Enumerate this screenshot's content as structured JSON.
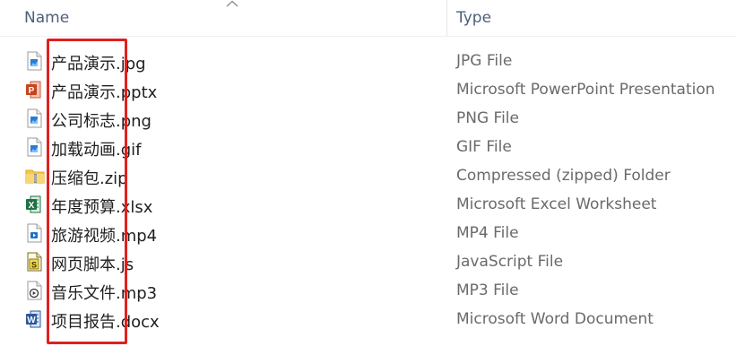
{
  "header": {
    "name_label": "Name",
    "type_label": "Type",
    "sort_icon": "chevron-up-icon"
  },
  "files": [
    {
      "name": "产品演示.jpg",
      "type": "JPG File",
      "icon": "image-file-icon"
    },
    {
      "name": "产品演示.pptx",
      "type": "Microsoft PowerPoint Presentation",
      "icon": "powerpoint-file-icon"
    },
    {
      "name": "公司标志.png",
      "type": "PNG File",
      "icon": "image-file-icon"
    },
    {
      "name": "加载动画.gif",
      "type": "GIF File",
      "icon": "image-file-icon"
    },
    {
      "name": "压缩包.zip",
      "type": "Compressed (zipped) Folder",
      "icon": "zip-folder-icon"
    },
    {
      "name": "年度预算.xlsx",
      "type": "Microsoft Excel Worksheet",
      "icon": "excel-file-icon"
    },
    {
      "name": "旅游视频.mp4",
      "type": "MP4 File",
      "icon": "video-file-icon"
    },
    {
      "name": "网页脚本.js",
      "type": "JavaScript File",
      "icon": "script-file-icon"
    },
    {
      "name": "音乐文件.mp3",
      "type": "MP3 File",
      "icon": "audio-file-icon"
    },
    {
      "name": "项目报告.docx",
      "type": "Microsoft Word Document",
      "icon": "word-file-icon"
    }
  ],
  "colors": {
    "highlight": "#e02020",
    "header_text": "#4c607a",
    "type_text": "#6a6a6a"
  }
}
